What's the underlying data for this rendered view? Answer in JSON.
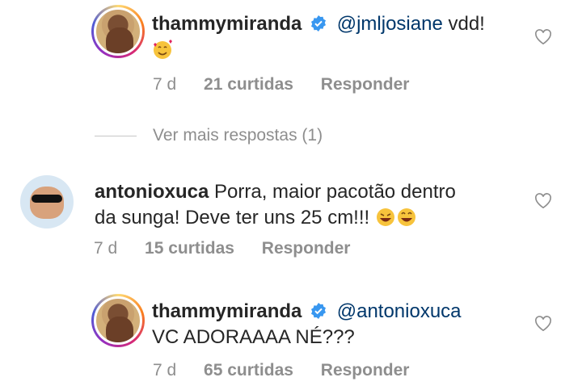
{
  "icons": {
    "like": "heart-outline-icon",
    "verified": "verified-badge-icon"
  },
  "colors": {
    "mention": "#00376b",
    "meta": "#8e8e8e",
    "verified": "#3897f0"
  },
  "comments": [
    {
      "username": "thammymiranda",
      "mention": "@jmljosiane",
      "text": "vdd!",
      "emoji": "smiling-face-with-hearts",
      "time": "7 d",
      "likes": "21 curtidas",
      "reply": "Responder"
    },
    {
      "view_more": "Ver mais respostas (1)"
    },
    {
      "username": "antonioxuca",
      "text_line1": "Porra, maior pacotão dentro",
      "text_line2": "da sunga! Deve ter uns 25 cm!!!",
      "emoji": "laughing-faces",
      "time": "7 d",
      "likes": "15 curtidas",
      "reply": "Responder"
    },
    {
      "username": "thammymiranda",
      "mention": "@antonioxuca",
      "text": "VC ADORAAAA NÉ???",
      "time": "7 d",
      "likes": "65 curtidas",
      "reply": "Responder"
    }
  ]
}
